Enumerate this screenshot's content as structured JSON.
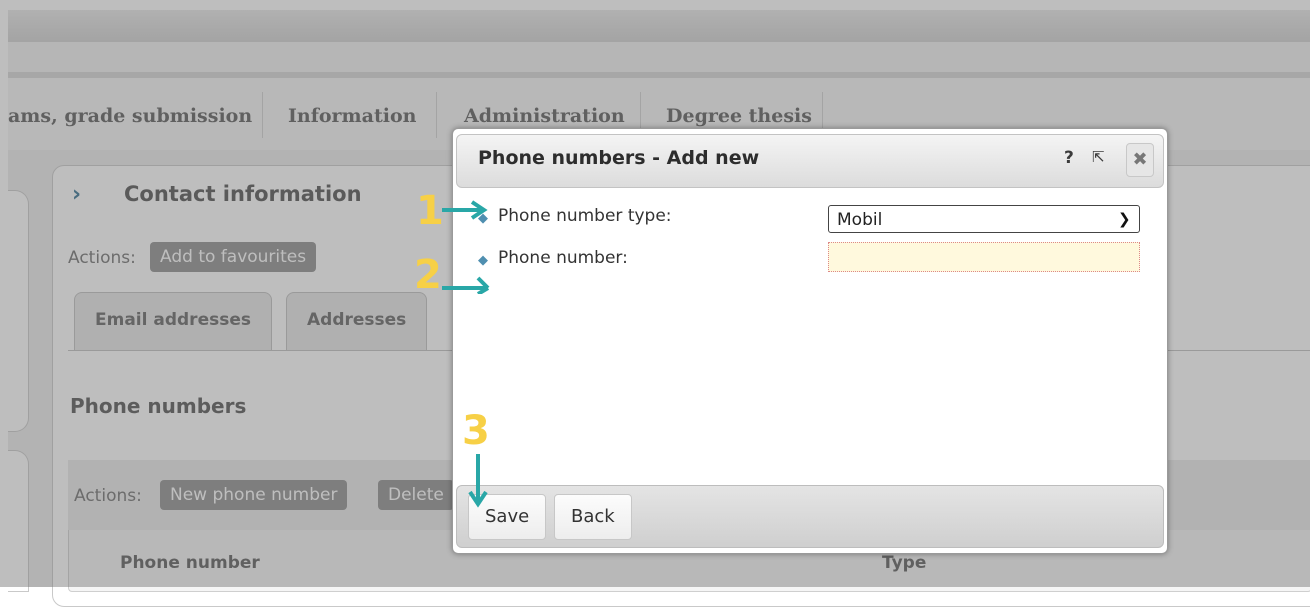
{
  "nav": {
    "items": [
      "ams, grade submission",
      "Information",
      "Administration",
      "Degree thesis"
    ]
  },
  "panel": {
    "title": "Contact information",
    "actions_label": "Actions:",
    "add_favourites": "Add to favourites",
    "tabs": [
      "Email addresses",
      "Addresses"
    ],
    "section_title": "Phone numbers",
    "list_actions_label": "Actions:",
    "new_phone_button": "New phone number",
    "delete_button": "Delete",
    "columns": [
      "Phone number",
      "Type"
    ]
  },
  "dialog": {
    "title": "Phone numbers - Add new",
    "help_icon": "?",
    "popout_icon": "⇱",
    "close_icon": "✖",
    "fields": {
      "type_label": "Phone number type:",
      "type_value": "Mobil",
      "number_label": "Phone number:"
    },
    "buttons": {
      "save": "Save",
      "back": "Back"
    }
  },
  "annotations": [
    "1",
    "2",
    "3"
  ],
  "colors": {
    "annotation_number": "#f7d046",
    "annotation_arrow": "#29a7a7",
    "input_highlight": "#fff9dd"
  }
}
